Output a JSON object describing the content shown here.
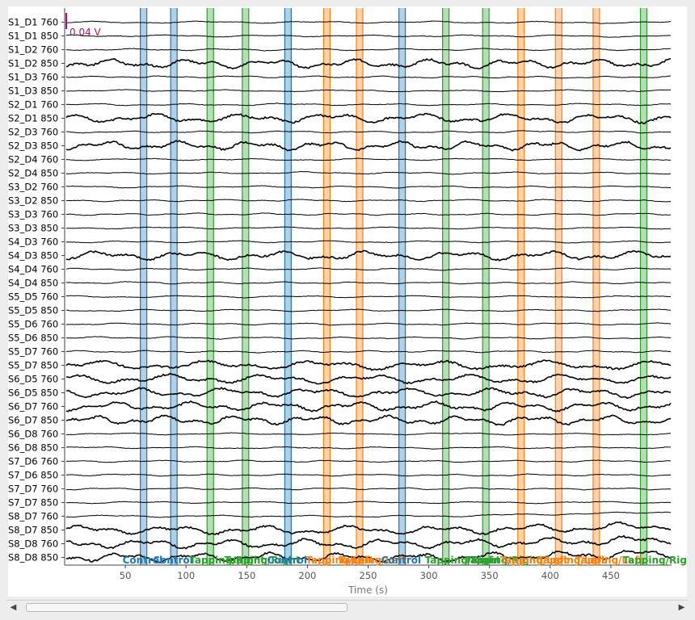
{
  "chart_data": {
    "type": "line",
    "xlabel": "Time (s)",
    "xlim": [
      0,
      500
    ],
    "xticks": [
      50,
      100,
      150,
      200,
      250,
      300,
      350,
      400,
      450
    ],
    "scale_bar_label": "0.04 V",
    "channels": [
      "S1_D1 760",
      "S1_D1 850",
      "S1_D2 760",
      "S1_D2 850",
      "S1_D3 760",
      "S1_D3 850",
      "S2_D1 760",
      "S2_D1 850",
      "S2_D3 760",
      "S2_D3 850",
      "S2_D4 760",
      "S2_D4 850",
      "S3_D2 760",
      "S3_D2 850",
      "S3_D3 760",
      "S3_D3 850",
      "S4_D3 760",
      "S4_D3 850",
      "S4_D4 760",
      "S4_D4 850",
      "S5_D5 760",
      "S5_D5 850",
      "S5_D6 760",
      "S5_D6 850",
      "S5_D7 760",
      "S5_D7 850",
      "S6_D5 760",
      "S6_D5 850",
      "S6_D7 760",
      "S6_D7 850",
      "S6_D8 760",
      "S6_D8 850",
      "S7_D6 760",
      "S7_D6 850",
      "S7_D7 760",
      "S7_D7 850",
      "S8_D7 760",
      "S8_D7 850",
      "S8_D8 760",
      "S8_D8 850"
    ],
    "annotation_colors": {
      "Control": "#1f77b4",
      "Tapping/Left": "#ff7f0e",
      "Tapping/Right": "#2ca02c"
    },
    "annotations": [
      {
        "t": 65,
        "type": "Control"
      },
      {
        "t": 90,
        "type": "Control"
      },
      {
        "t": 120,
        "type": "Tapping/Right"
      },
      {
        "t": 149,
        "type": "Tapping/Right"
      },
      {
        "t": 184,
        "type": "Control"
      },
      {
        "t": 216,
        "type": "Tapping/Left"
      },
      {
        "t": 243,
        "type": "Tapping/Left"
      },
      {
        "t": 278,
        "type": "Control"
      },
      {
        "t": 314,
        "type": "Tapping/Right"
      },
      {
        "t": 347,
        "type": "Tapping/Right"
      },
      {
        "t": 376,
        "type": "Tapping/Left"
      },
      {
        "t": 407,
        "type": "Tapping/Left"
      },
      {
        "t": 438,
        "type": "Tapping/Left"
      },
      {
        "t": 477,
        "type": "Tapping/Right"
      }
    ],
    "signal_look": {
      "note_free": true,
      "high_amplitude_channels": [
        3,
        7,
        9,
        17,
        25,
        26,
        27,
        28,
        29,
        37,
        38,
        39
      ]
    }
  },
  "scrollbar": {
    "left_arrow": "◀",
    "right_arrow": "▶"
  }
}
